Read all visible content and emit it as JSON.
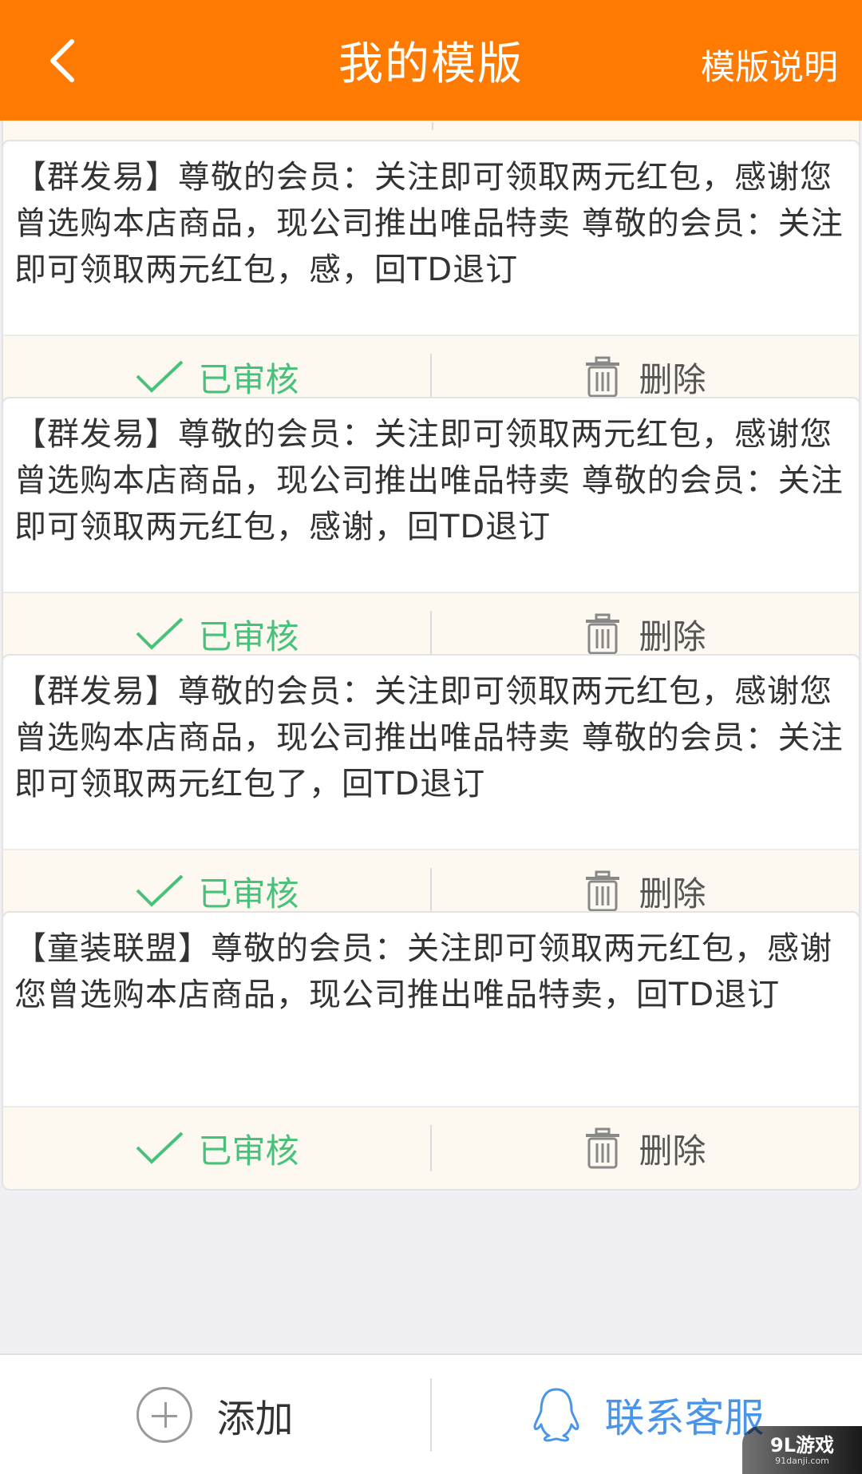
{
  "header": {
    "title": "我的模版",
    "action_label": "模版说明"
  },
  "cards": [
    {
      "text": "【群发易】尊敬的会员：关注即可领取两元红包，感谢您曾选购本店商品，现公司推出唯品特卖 尊敬的会员：关注即可领取两元红包，感，回TD退订",
      "status_label": "已审核",
      "delete_label": "删除"
    },
    {
      "text": "【群发易】尊敬的会员：关注即可领取两元红包，感谢您曾选购本店商品，现公司推出唯品特卖 尊敬的会员：关注即可领取两元红包，感谢，回TD退订",
      "status_label": "已审核",
      "delete_label": "删除"
    },
    {
      "text": "【群发易】尊敬的会员：关注即可领取两元红包，感谢您曾选购本店商品，现公司推出唯品特卖 尊敬的会员：关注即可领取两元红包了，回TD退订",
      "status_label": "已审核",
      "delete_label": "删除"
    },
    {
      "text": "【童装联盟】尊敬的会员：关注即可领取两元红包，感谢您曾选购本店商品，现公司推出唯品特卖，回TD退订",
      "status_label": "已审核",
      "delete_label": "删除"
    }
  ],
  "bottom_bar": {
    "add_label": "添加",
    "service_label": "联系客服"
  },
  "watermark": {
    "main": "9L游戏",
    "sub": "91danji.com"
  },
  "colors": {
    "header_bg": "#ff7a00",
    "approved_green": "#46c27a",
    "service_blue": "#4a95e8",
    "action_bar_bg": "#fdf9f0"
  }
}
